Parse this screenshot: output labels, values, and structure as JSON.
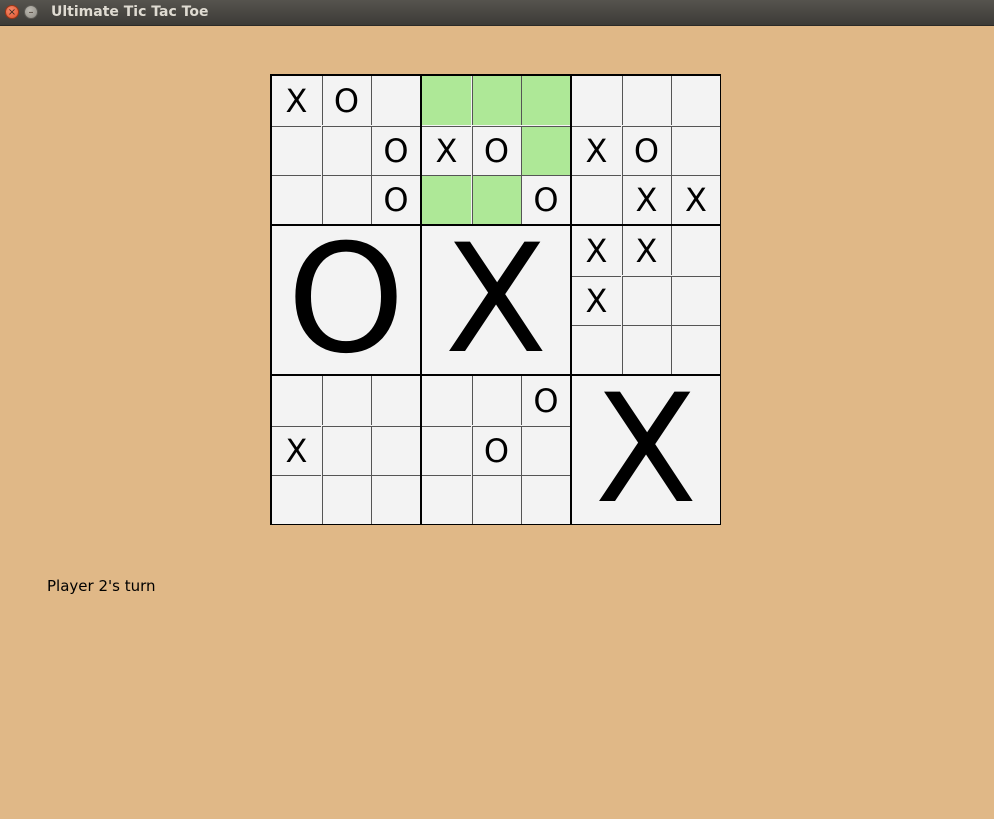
{
  "window": {
    "title": "Ultimate Tic Tac Toe",
    "close_glyph": "×",
    "minimize_glyph": "–"
  },
  "status": "Player 2's turn",
  "colors": {
    "background": "#e0b887",
    "cell": "#f3f3f3",
    "highlight": "#aee897",
    "grid": "#000000"
  },
  "board": [
    {
      "winner": null,
      "cells": [
        "X",
        "O",
        "",
        "",
        "",
        "O",
        "",
        "",
        "O"
      ],
      "highlight": [
        false,
        false,
        false,
        false,
        false,
        false,
        false,
        false,
        false
      ]
    },
    {
      "winner": null,
      "cells": [
        "",
        "",
        "",
        "X",
        "O",
        "",
        "",
        "",
        "O"
      ],
      "highlight": [
        true,
        true,
        true,
        false,
        false,
        true,
        true,
        true,
        false
      ]
    },
    {
      "winner": null,
      "cells": [
        "",
        "",
        "",
        "X",
        "O",
        "",
        "",
        "X",
        "X"
      ],
      "highlight": [
        false,
        false,
        false,
        false,
        false,
        false,
        false,
        false,
        false
      ]
    },
    {
      "winner": "O",
      "cells": [
        "",
        "",
        "",
        "",
        "",
        "",
        "",
        "",
        ""
      ],
      "highlight": [
        false,
        false,
        false,
        false,
        false,
        false,
        false,
        false,
        false
      ]
    },
    {
      "winner": "X",
      "cells": [
        "",
        "",
        "",
        "",
        "",
        "",
        "",
        "",
        ""
      ],
      "highlight": [
        false,
        false,
        false,
        false,
        false,
        false,
        false,
        false,
        false
      ]
    },
    {
      "winner": null,
      "cells": [
        "X",
        "X",
        "",
        "X",
        "",
        "",
        "",
        "",
        ""
      ],
      "highlight": [
        false,
        false,
        false,
        false,
        false,
        false,
        false,
        false,
        false
      ]
    },
    {
      "winner": null,
      "cells": [
        "",
        "",
        "",
        "X",
        "",
        "",
        "",
        "",
        ""
      ],
      "highlight": [
        false,
        false,
        false,
        false,
        false,
        false,
        false,
        false,
        false
      ]
    },
    {
      "winner": null,
      "cells": [
        "",
        "",
        "O",
        "",
        "O",
        "",
        "",
        "",
        ""
      ],
      "highlight": [
        false,
        false,
        false,
        false,
        false,
        false,
        false,
        false,
        false
      ]
    },
    {
      "winner": "X",
      "cells": [
        "",
        "",
        "",
        "",
        "",
        "",
        "",
        "",
        ""
      ],
      "highlight": [
        false,
        false,
        false,
        false,
        false,
        false,
        false,
        false,
        false
      ]
    }
  ]
}
